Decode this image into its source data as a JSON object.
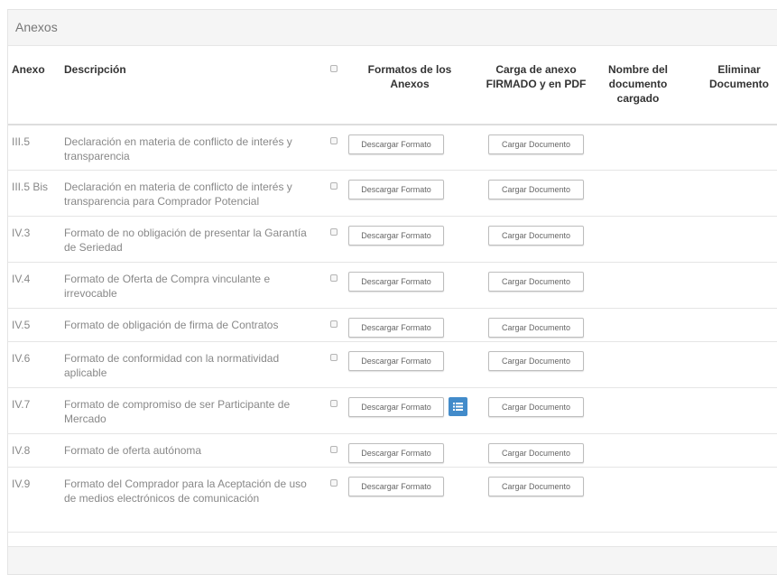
{
  "panel": {
    "title": "Anexos"
  },
  "table": {
    "headers": {
      "anexo": "Anexo",
      "descripcion": "Descripción",
      "formatos": "Formatos de los Anexos",
      "carga": "Carga de anexo FIRMADO y en PDF",
      "nombre": "Nombre del documento cargado",
      "eliminar": "Eliminar Documento"
    },
    "download_label": "Descargar Formato",
    "upload_label": "Cargar Documento",
    "rows": [
      {
        "anexo": "III.5",
        "descripcion": "Declaración en materia de conflicto de interés y transparencia",
        "has_info": false
      },
      {
        "anexo": "III.5 Bis",
        "descripcion": "Declaración en materia de conflicto de interés y transparencia para Comprador Potencial",
        "has_info": false
      },
      {
        "anexo": "IV.3",
        "descripcion": "Formato de no obligación de presentar la Garantía de Seriedad",
        "has_info": false
      },
      {
        "anexo": "IV.4",
        "descripcion": "Formato de Oferta de Compra vinculante e irrevocable",
        "has_info": false
      },
      {
        "anexo": "IV.5",
        "descripcion": "Formato de obligación de firma de Contratos",
        "has_info": false
      },
      {
        "anexo": "IV.6",
        "descripcion": "Formato de conformidad con la normatividad aplicable",
        "has_info": false
      },
      {
        "anexo": "IV.7",
        "descripcion": "Formato de compromiso de ser Participante de Mercado",
        "has_info": true
      },
      {
        "anexo": "IV.8",
        "descripcion": "Formato de oferta autónoma",
        "has_info": false
      },
      {
        "anexo": "IV.9",
        "descripcion": "Formato del Comprador para la Aceptación de uso de medios electrónicos de comunicación",
        "has_info": false
      }
    ]
  }
}
